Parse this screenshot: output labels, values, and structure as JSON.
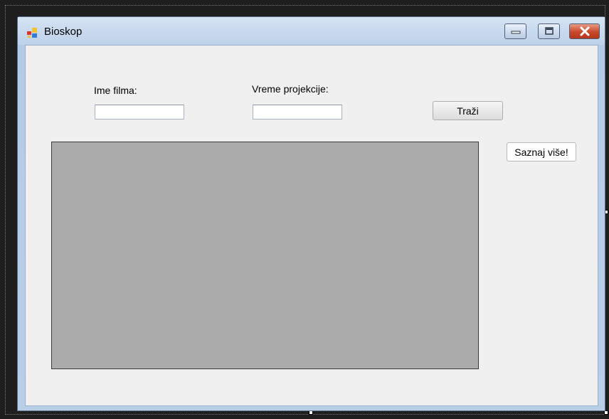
{
  "window": {
    "title": "Bioskop",
    "app_icon": "form-icon",
    "controls": {
      "minimize_icon": "minimize-icon",
      "maximize_icon": "maximize-icon",
      "close_icon": "close-icon",
      "close_color": "#c7482b"
    }
  },
  "form": {
    "movie_name_label": "Ime filma:",
    "movie_name_value": "",
    "showtime_label": "Vreme projekcije:",
    "showtime_value": "",
    "search_button": "Traži",
    "learn_more_button": "Saznaj više!"
  },
  "grid": {
    "background": "#ababab"
  }
}
